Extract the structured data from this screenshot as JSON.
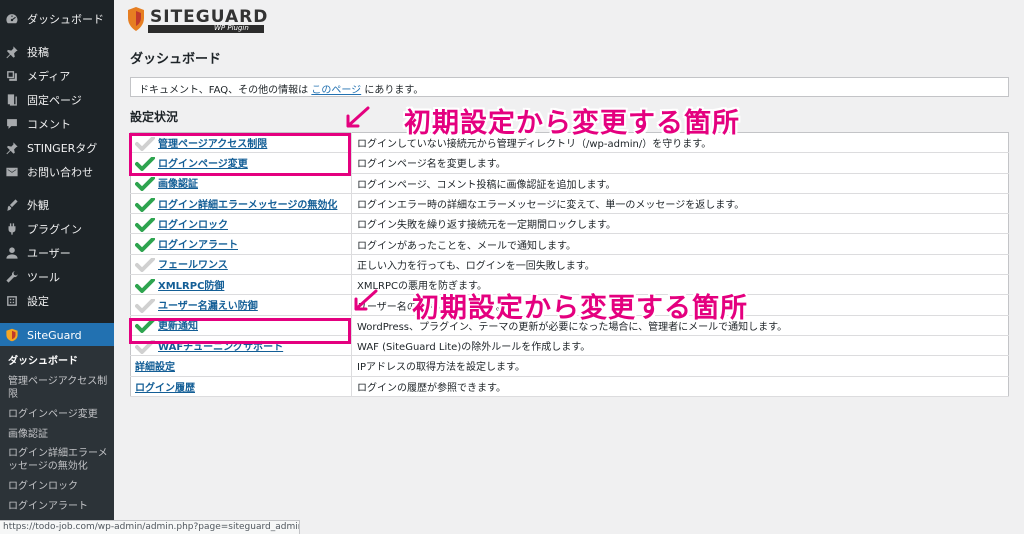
{
  "sidebar": {
    "items": [
      {
        "label": "ダッシュボード",
        "icon": "dashboard-icon"
      },
      {
        "label": "投稿",
        "icon": "pin-icon"
      },
      {
        "label": "メディア",
        "icon": "media-icon"
      },
      {
        "label": "固定ページ",
        "icon": "page-icon"
      },
      {
        "label": "コメント",
        "icon": "comment-icon"
      },
      {
        "label": "STINGERタグ",
        "icon": "pin-icon"
      },
      {
        "label": "お問い合わせ",
        "icon": "mail-icon"
      },
      {
        "label": "外観",
        "icon": "brush-icon"
      },
      {
        "label": "プラグイン",
        "icon": "plugin-icon"
      },
      {
        "label": "ユーザー",
        "icon": "user-icon"
      },
      {
        "label": "ツール",
        "icon": "wrench-icon"
      },
      {
        "label": "設定",
        "icon": "settings-icon"
      },
      {
        "label": "SiteGuard",
        "icon": "siteguard-icon"
      }
    ],
    "submenu": [
      "ダッシュボード",
      "管理ページアクセス制限",
      "ログインページ変更",
      "画像認証",
      "ログイン詳細エラーメッセージの無効化",
      "ログインロック",
      "ログインアラート"
    ]
  },
  "logo": {
    "text": "SITEGUARD",
    "sub": "WP Plugin"
  },
  "page_title": "ダッシュボード",
  "info": {
    "prefix": "ドキュメント、FAQ、その他の情報は ",
    "link": "このページ",
    "suffix": " にあります。"
  },
  "section_title": "設定状況",
  "features": [
    {
      "name": "管理ページアクセス制限",
      "desc": "ログインしていない接続元から管理ディレクトリ（/wp-admin/）を守ります。",
      "enabled": false
    },
    {
      "name": "ログインページ変更",
      "desc": "ログインページ名を変更します。",
      "enabled": true
    },
    {
      "name": "画像認証",
      "desc": "ログインページ、コメント投稿に画像認証を追加します。",
      "enabled": true
    },
    {
      "name": "ログイン詳細エラーメッセージの無効化",
      "desc": "ログインエラー時の詳細なエラーメッセージに変えて、単一のメッセージを返します。",
      "enabled": true
    },
    {
      "name": "ログインロック",
      "desc": "ログイン失敗を繰り返す接続元を一定期間ロックします。",
      "enabled": true
    },
    {
      "name": "ログインアラート",
      "desc": "ログインがあったことを、メールで通知します。",
      "enabled": true
    },
    {
      "name": "フェールワンス",
      "desc": "正しい入力を行っても、ログインを一回失敗します。",
      "enabled": false
    },
    {
      "name": "XMLRPC防御",
      "desc": "XMLRPCの悪用を防ぎます。",
      "enabled": true
    },
    {
      "name": "ユーザー名漏えい防御",
      "desc": "ユーザー名の漏えいを防ぎます。",
      "enabled": false
    },
    {
      "name": "更新通知",
      "desc": "WordPress、プラグイン、テーマの更新が必要になった場合に、管理者にメールで通知します。",
      "enabled": true
    },
    {
      "name": "WAFチューニングサポート",
      "desc": "WAF (SiteGuard Lite)の除外ルールを作成します。",
      "enabled": false
    },
    {
      "name": "詳細設定",
      "desc": "IPアドレスの取得方法を設定します。",
      "enabled": null
    },
    {
      "name": "ログイン履歴",
      "desc": "ログインの履歴が参照できます。",
      "enabled": null
    }
  ],
  "annotations": [
    {
      "text": "初期設定から変更する箇所"
    },
    {
      "text": "初期設定から変更する箇所"
    }
  ],
  "statusbar": "https://todo-job.com/wp-admin/admin.php?page=siteguard_admin_filter",
  "colors": {
    "sidebar": "#1d2327",
    "accent": "#2271b1",
    "check": "#2ea44f",
    "annotation": "#e4007f"
  }
}
